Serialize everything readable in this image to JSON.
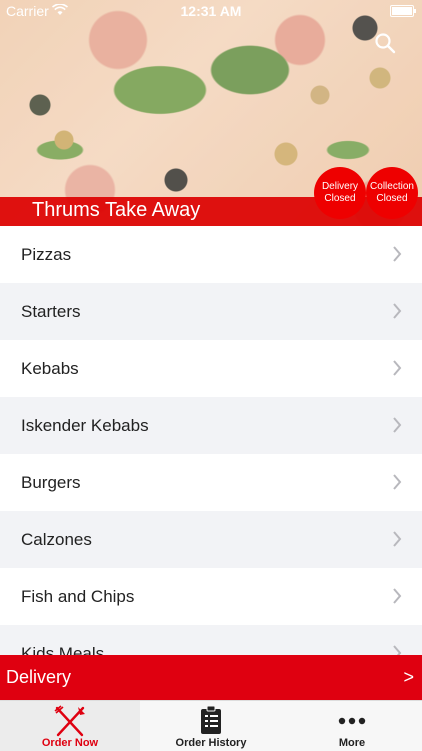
{
  "status_bar": {
    "carrier": "Carrier",
    "time": "12:31 AM"
  },
  "header": {
    "title": "Thrums Take Away",
    "delivery_status": {
      "line1": "Delivery",
      "line2": "Closed"
    },
    "collection_status": {
      "line1": "Collection",
      "line2": "Closed"
    },
    "accent_color": "#df0010"
  },
  "categories": [
    {
      "label": "Pizzas"
    },
    {
      "label": "Starters"
    },
    {
      "label": "Kebabs"
    },
    {
      "label": "Iskender Kebabs"
    },
    {
      "label": "Burgers"
    },
    {
      "label": "Calzones"
    },
    {
      "label": "Fish and Chips"
    },
    {
      "label": "Kids Meals"
    }
  ],
  "delivery_bar": {
    "label": "Delivery",
    "arrow": ">"
  },
  "tabs": [
    {
      "label": "Order Now",
      "icon": "fork-knife-icon",
      "active": true
    },
    {
      "label": "Order History",
      "icon": "clipboard-icon",
      "active": false
    },
    {
      "label": "More",
      "icon": "more-dots-icon",
      "active": false
    }
  ]
}
